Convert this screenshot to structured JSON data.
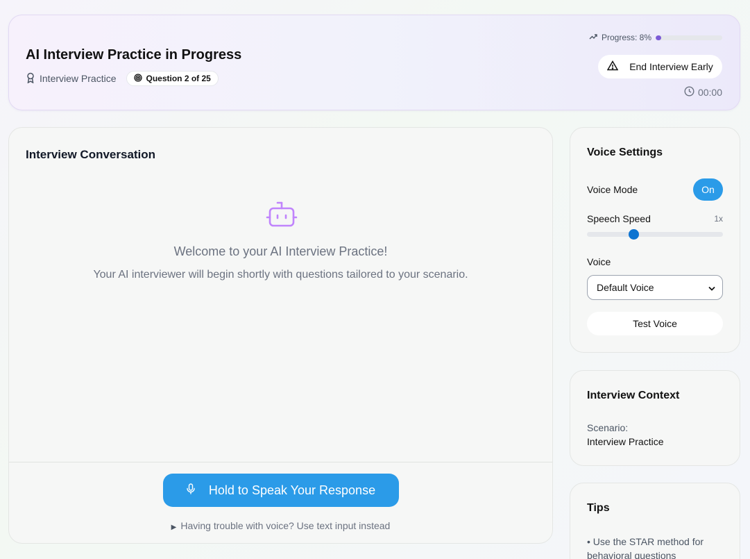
{
  "header": {
    "title": "AI Interview Practice in Progress",
    "scenario_label": "Interview Practice",
    "question_badge": "Question 2 of 25",
    "progress_label": "Progress: 8%",
    "progress_value": 0.08,
    "end_button": "End Interview Early",
    "timer": "00:00"
  },
  "conversation": {
    "title": "Interview Conversation",
    "welcome_title": "Welcome to your AI Interview Practice!",
    "welcome_text": "Your AI interviewer will begin shortly with questions tailored to your scenario.",
    "speak_button": "Hold to Speak Your Response",
    "text_fallback": "Having trouble with voice? Use text input instead"
  },
  "voice_settings": {
    "title": "Voice Settings",
    "voice_mode_label": "Voice Mode",
    "voice_mode_value": "On",
    "speech_speed_label": "Speech Speed",
    "speech_speed_value": "1x",
    "speech_speed_fraction": 0.34,
    "voice_label": "Voice",
    "voice_selected": "Default Voice",
    "test_button": "Test Voice"
  },
  "interview_context": {
    "title": "Interview Context",
    "scenario_label": "Scenario:",
    "scenario_value": "Interview Practice"
  },
  "tips": {
    "title": "Tips",
    "items": [
      "• Use the STAR method for behavioral questions"
    ]
  },
  "colors": {
    "accent_blue": "#2b9be8",
    "progress_purple": "#7c5bd6",
    "bot_purple": "#c084fc"
  }
}
